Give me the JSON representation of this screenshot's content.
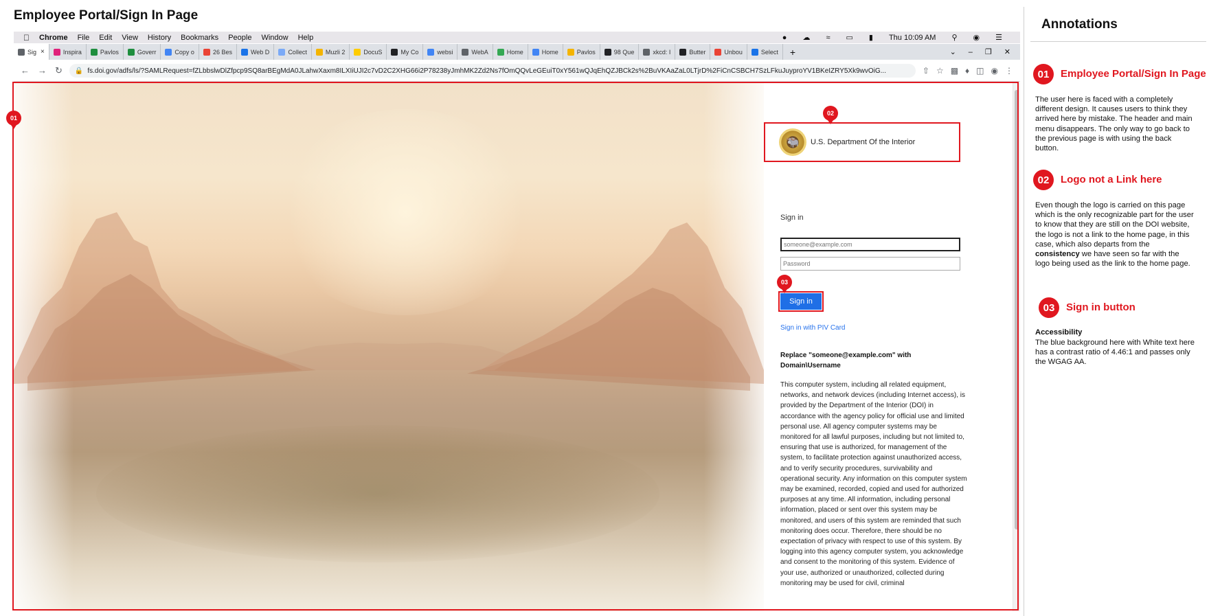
{
  "page_title": "Employee Portal/Sign In Page",
  "annotations_title": "Annotations",
  "menubar": {
    "app": "Chrome",
    "items": [
      "File",
      "Edit",
      "View",
      "History",
      "Bookmarks",
      "People",
      "Window",
      "Help"
    ],
    "clock": "Thu 10:09 AM"
  },
  "tabs": [
    {
      "label": "Sig",
      "color": "#5f6368",
      "active": true
    },
    {
      "label": "Inspira",
      "color": "#e0217a"
    },
    {
      "label": "Pavlos",
      "color": "#1e8e3e"
    },
    {
      "label": "Goverr",
      "color": "#1e8e3e"
    },
    {
      "label": "Copy o",
      "color": "#4285f4"
    },
    {
      "label": "26 Bes",
      "color": "#ea4335"
    },
    {
      "label": "Web D",
      "color": "#1a73e8"
    },
    {
      "label": "Collect",
      "color": "#7baaf7"
    },
    {
      "label": "Muzli 2",
      "color": "#f4b400"
    },
    {
      "label": "DocuS",
      "color": "#ffcc00"
    },
    {
      "label": "My Co",
      "color": "#202124"
    },
    {
      "label": "websi",
      "color": "#4285f4"
    },
    {
      "label": "WebA",
      "color": "#5f6368"
    },
    {
      "label": "Home",
      "color": "#34a853"
    },
    {
      "label": "Home",
      "color": "#4285f4"
    },
    {
      "label": "Pavlos",
      "color": "#f4b400"
    },
    {
      "label": "98 Que",
      "color": "#202124"
    },
    {
      "label": "xkcd: I",
      "color": "#5f6368"
    },
    {
      "label": "Butter",
      "color": "#202124"
    },
    {
      "label": "Unbou",
      "color": "#ea4335"
    },
    {
      "label": "Select",
      "color": "#1a73e8"
    }
  ],
  "address": {
    "url": "fs.doi.gov/adfs/ls/?SAMLRequest=fZLbbslwDlZfpcp9SQ8arBEgMdA0JLahwXaxm8ILXIiUJI2c7vD2C2XHG66i2P78238yJmhMK2Zd2Ns7fOmQQvLeGEuiT0xY561wQJqEhQZJBCk2s%2BuVKAaZaL0LTjrD%2FiCnCSBCH7SzLFkuJuyproYV1BKeIZRY5Xk9wvOiG..."
  },
  "login": {
    "org_name": "U.S. Department Of the Interior",
    "signin_title": "Sign in",
    "email_placeholder": "someone@example.com",
    "password_placeholder": "Password",
    "signin_button": "Sign in",
    "piv_link": "Sign in with PIV Card",
    "replace_note": "Replace \"someone@example.com\" with Domain\\Username",
    "disclaimer": "This computer system, including all related equipment, networks, and network devices (including Internet access), is provided by the Department of the Interior (DOI) in accordance with the agency policy for official use and limited personal use. All agency computer systems may be monitored for all lawful purposes, including but not limited to, ensuring that use is authorized, for management of the system, to facilitate protection against unauthorized access, and to verify security procedures, survivability and operational security. Any information on this computer system may be examined, recorded, copied and used for authorized purposes at any time. All information, including personal information, placed or sent over this system may be monitored, and users of this system are reminded that such monitoring does occur. Therefore, there should be no expectation of privacy with respect to use of this system. By logging into this agency computer system, you acknowledge and consent to the monitoring of this system. Evidence of your use, authorized or unauthorized, collected during monitoring may be used for civil, criminal"
  },
  "markers": {
    "m1": "01",
    "m2": "02",
    "m3": "03"
  },
  "annotations": [
    {
      "num": "01",
      "heading": "Employee Portal/Sign In Page",
      "body": "The user here is faced with a completely different design. It causes users to think they arrived here by mistake. The header and main menu disappears. The only way to go back to the previous page is with using the back button."
    },
    {
      "num": "02",
      "heading": "Logo not a Link here",
      "body_pre": "Even though the logo is carried on this page which is the only recognizable part for the user to know that they are still on the DOI website, the logo is not a link to the home page, in this case, which also departs from the ",
      "body_bold": "consistency",
      "body_post": " we have seen so far with the logo being used as the link to the home page."
    },
    {
      "num": "03",
      "heading": "Sign in button",
      "subheading": "Accessibility",
      "body": "The blue background here with White text here has a contrast ratio of 4.46:1 and passes only the WGAG AA."
    }
  ],
  "colors": {
    "accent_red": "#e0171f",
    "signin_blue": "#1f6fe6",
    "link_blue": "#2672ec"
  }
}
